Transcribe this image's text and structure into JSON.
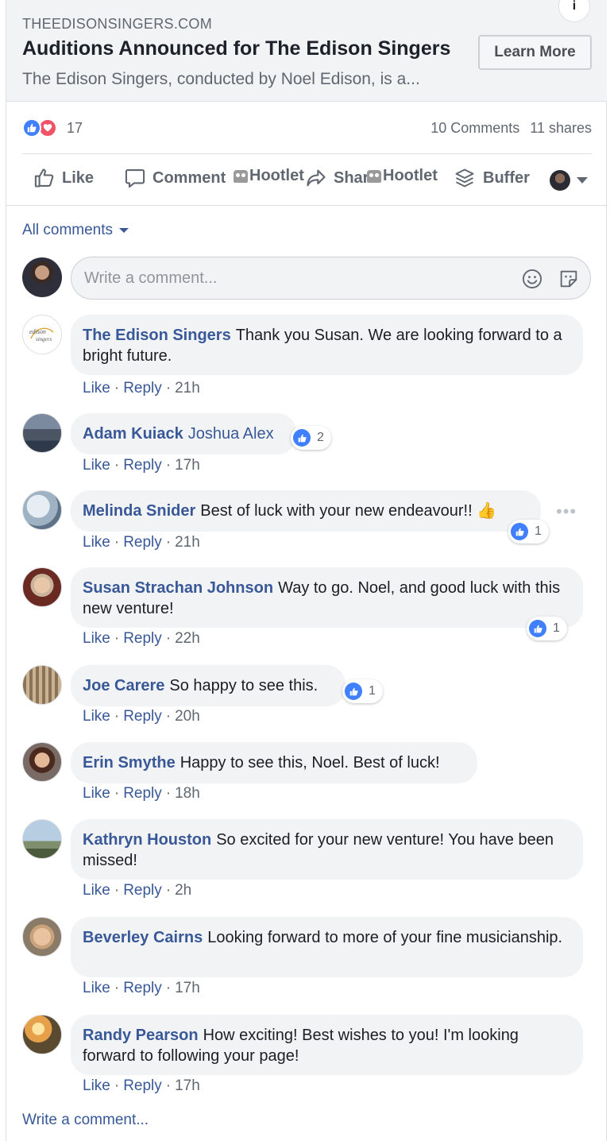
{
  "link_preview": {
    "domain": "THEEDISONSINGERS.COM",
    "title": "Auditions Announced for The Edison Singers",
    "description": "The Edison Singers, conducted by Noel Edison, is a...",
    "cta": "Learn More"
  },
  "stats": {
    "reaction_count": "17",
    "comments": "10 Comments",
    "shares": "11 shares"
  },
  "actions": {
    "like": "Like",
    "comment": "Comment",
    "hootlet1": "Hootlet",
    "share": "Share",
    "hootlet2": "Hootlet",
    "buffer": "Buffer"
  },
  "all_comments": "All comments",
  "write_placeholder": "Write a comment...",
  "comments": [
    {
      "name": "The Edison Singers",
      "text": "Thank you Susan. We are looking forward to a bright future.",
      "like": "Like",
      "reply": "Reply",
      "time": "21h"
    },
    {
      "name": "Adam Kuiack",
      "tag": "Joshua Alex",
      "text": "",
      "like": "Like",
      "reply": "Reply",
      "time": "17h",
      "reactions": "2"
    },
    {
      "name": "Melinda Snider",
      "text": "Best of luck with your new endeavour!! 👍",
      "like": "Like",
      "reply": "Reply",
      "time": "21h",
      "reactions": "1"
    },
    {
      "name": "Susan Strachan Johnson",
      "text": "Way to go. Noel, and good luck with this new venture!",
      "like": "Like",
      "reply": "Reply",
      "time": "22h",
      "reactions": "1"
    },
    {
      "name": "Joe Carere",
      "text": "So happy to see this.",
      "like": "Like",
      "reply": "Reply",
      "time": "20h",
      "reactions": "1"
    },
    {
      "name": "Erin Smythe",
      "text": "Happy to see this, Noel. Best of luck!",
      "like": "Like",
      "reply": "Reply",
      "time": "18h"
    },
    {
      "name": "Kathryn Houston",
      "text": "So excited for your new venture! You have been missed!",
      "like": "Like",
      "reply": "Reply",
      "time": "2h"
    },
    {
      "name": "Beverley Cairns",
      "text": "Looking forward to more of your fine musicianship.",
      "like": "Like",
      "reply": "Reply",
      "time": "17h"
    },
    {
      "name": "Randy Pearson",
      "text": "How exciting! Best wishes to you! I'm looking forward to following your page!",
      "like": "Like",
      "reply": "Reply",
      "time": "17h"
    }
  ],
  "write_bottom": "Write a comment...",
  "colors": {
    "link": "#385898",
    "like": "#4080ff",
    "love": "#f25268",
    "bubble": "#f2f3f5"
  }
}
